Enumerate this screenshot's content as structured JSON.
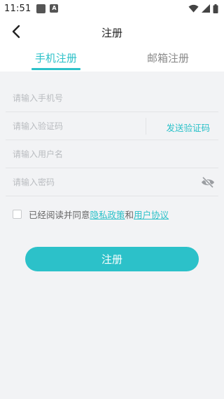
{
  "status_bar": {
    "time": "11:51",
    "a_icon": "A"
  },
  "header": {
    "title": "注册",
    "back_icon": "chevron-left-icon"
  },
  "tabs": [
    {
      "label": "手机注册",
      "active": true
    },
    {
      "label": "邮箱注册",
      "active": false
    }
  ],
  "form": {
    "phone_placeholder": "请输入手机号",
    "code_placeholder": "请输入验证码",
    "send_code_label": "发送验证码",
    "username_placeholder": "请输入用户名",
    "password_placeholder": "请输入密码"
  },
  "agreement": {
    "prefix": "已经阅读并同意",
    "privacy_link": "隐私政策",
    "and": "和",
    "terms_link": "用户协议",
    "checked": false
  },
  "submit_label": "注册",
  "colors": {
    "accent": "#2cc1c9",
    "background": "#f2f3f5"
  }
}
